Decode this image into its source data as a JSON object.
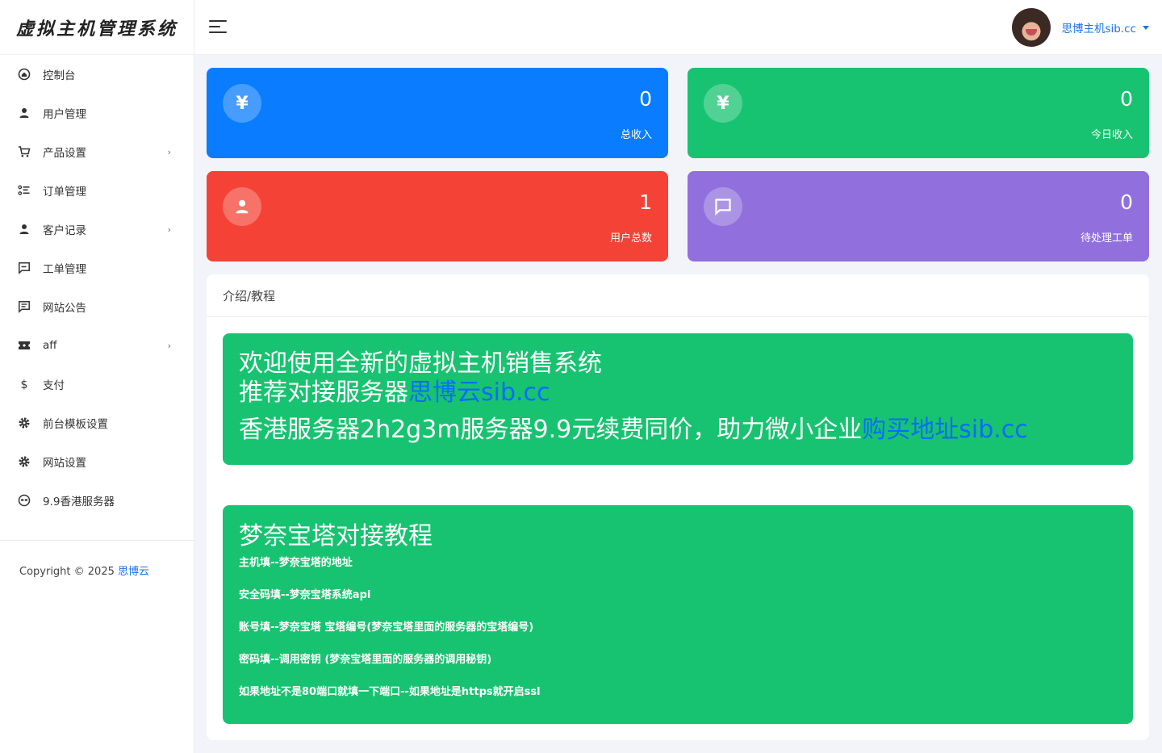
{
  "brand": {
    "title": "虚拟主机管理系统"
  },
  "sidebar": {
    "items": [
      {
        "label": "控制台",
        "icon": "dashboard-icon",
        "has_children": false
      },
      {
        "label": "用户管理",
        "icon": "user-icon",
        "has_children": false
      },
      {
        "label": "产品设置",
        "icon": "cart-icon",
        "has_children": true
      },
      {
        "label": "订单管理",
        "icon": "list-icon",
        "has_children": false
      },
      {
        "label": "客户记录",
        "icon": "user-icon",
        "has_children": true
      },
      {
        "label": "工单管理",
        "icon": "message-icon",
        "has_children": false
      },
      {
        "label": "网站公告",
        "icon": "announcement-icon",
        "has_children": false
      },
      {
        "label": "aff",
        "icon": "ticket-icon",
        "has_children": true
      },
      {
        "label": "支付",
        "icon": "dollar-icon",
        "has_children": false
      },
      {
        "label": "前台模板设置",
        "icon": "gear-icon",
        "has_children": false
      },
      {
        "label": "网站设置",
        "icon": "gear-icon",
        "has_children": false
      },
      {
        "label": "9.9香港服务器",
        "icon": "alien-icon",
        "has_children": false
      }
    ],
    "chevron": "›",
    "copyright_prefix": "Copyright © 2025",
    "copyright_link": "思博云"
  },
  "header": {
    "user_name": "思博主机sib.cc"
  },
  "stats": [
    {
      "value": "0",
      "label": "总收入",
      "icon": "yen-icon",
      "glyph": "¥",
      "color": "#0a7cff"
    },
    {
      "value": "0",
      "label": "今日收入",
      "icon": "yen-icon",
      "glyph": "¥",
      "color": "#17c370"
    },
    {
      "value": "1",
      "label": "用户总数",
      "icon": "user-icon",
      "color": "#f44336"
    },
    {
      "value": "0",
      "label": "待处理工单",
      "icon": "message-icon",
      "color": "#9170dd"
    }
  ],
  "intro": {
    "title": "介绍/教程",
    "panel1": {
      "line1": "欢迎使用全新的虚拟主机销售系统",
      "line2_text": "推荐对接服务器",
      "line2_link": "思博云sib.cc",
      "line3_text": "香港服务器2h2g3m服务器9.9元续费同价，助力微小企业",
      "line3_link": "购买地址sib.cc"
    },
    "panel2": {
      "title": "梦奈宝塔对接教程",
      "steps": [
        "主机填--梦奈宝塔的地址",
        "安全码填--梦奈宝塔系统api",
        "账号填--梦奈宝塔 宝塔编号(梦奈宝塔里面的服务器的宝塔编号)",
        "密码填--调用密钥 (梦奈宝塔里面的服务器的调用秘钥)",
        "如果地址不是80端口就填一下端口--如果地址是https就开启ssl"
      ]
    }
  }
}
